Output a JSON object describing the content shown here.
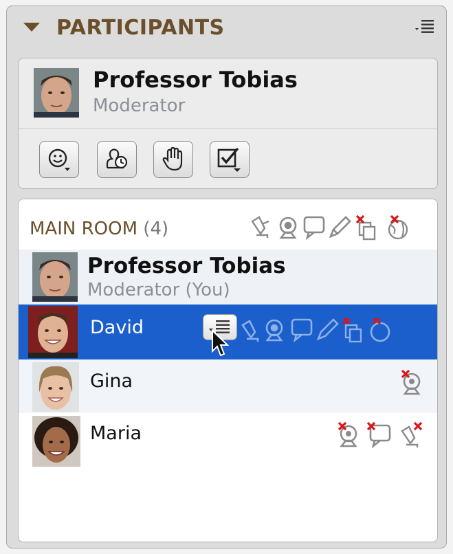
{
  "header": {
    "title": "PARTICIPANTS",
    "menu_icon": "list-menu-icon",
    "collapse_icon": "triangle-down-icon"
  },
  "me": {
    "name": "Professor Tobias",
    "role": "Moderator"
  },
  "toolbar": {
    "buttons": [
      {
        "icon": "emoticon-icon"
      },
      {
        "icon": "away-status-icon"
      },
      {
        "icon": "raise-hand-icon"
      },
      {
        "icon": "poll-check-icon"
      }
    ]
  },
  "room": {
    "title": "MAIN ROOM",
    "count": "(4)",
    "column_icons": [
      "speaker-icon",
      "webcam-icon",
      "chat-icon",
      "pencil-icon",
      "copy-disabled-icon",
      "globe-disabled-icon"
    ]
  },
  "participants": [
    {
      "name": "Professor Tobias",
      "role": "Moderator (You)",
      "selected": false
    },
    {
      "name": "David",
      "selected": true
    },
    {
      "name": "Gina",
      "selected": false,
      "status_icons": [
        "webcam-disabled-icon"
      ]
    },
    {
      "name": "Maria",
      "selected": false,
      "status_icons": [
        "webcam-disabled-icon",
        "chat-disabled-icon",
        "speaker-disabled-icon"
      ]
    }
  ],
  "colors": {
    "accent": "#6a4f2a",
    "selection": "#1a5fcc",
    "role_text": "#8a9098"
  }
}
